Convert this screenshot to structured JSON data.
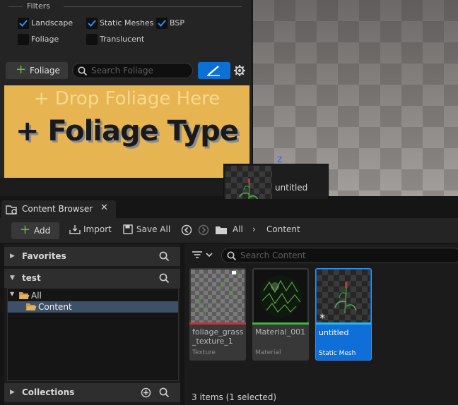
{
  "foliage_panel": {
    "filters_label": "Filters",
    "filters": [
      {
        "label": "Landscape",
        "checked": true
      },
      {
        "label": "Static Meshes",
        "checked": true
      },
      {
        "label": "BSP",
        "checked": true
      },
      {
        "label": "Foliage",
        "checked": false
      },
      {
        "label": "Translucent",
        "checked": false
      }
    ],
    "add_foliage_label": "Foliage",
    "search_placeholder": "Search Foliage",
    "drop_hint": "+ Drop Foliage Here",
    "drop_title": "+ Foliage Type"
  },
  "viewport": {
    "axis_label": "Z"
  },
  "drag_tooltip": {
    "asset_name": "untitled"
  },
  "content_browser": {
    "tab_label": "Content Browser",
    "tab_close": "✕",
    "toolbar": {
      "add_label": "Add",
      "import_label": "Import",
      "save_all_label": "Save All",
      "path": [
        "All",
        "Content"
      ]
    },
    "sources": {
      "favorites_label": "Favorites",
      "project_label": "test",
      "tree": [
        {
          "label": "All",
          "selected": false
        },
        {
          "label": "Content",
          "selected": true
        }
      ],
      "collections_label": "Collections"
    },
    "asset_search_placeholder": "Search Content",
    "assets": [
      {
        "name": "foliage_grass_texture_1",
        "type": "Texture",
        "strip_color": "#c0353b",
        "selected": false
      },
      {
        "name": "Material_001",
        "type": "Material",
        "strip_color": "#40b540",
        "selected": false
      },
      {
        "name": "untitled",
        "type": "Static Mesh",
        "strip_color": "#28b8e8",
        "selected": true
      }
    ],
    "status": "3 items (1 selected)"
  },
  "colors": {
    "accent_blue": "#0f6ed8",
    "add_green": "#5fbf3f",
    "drop_zone": "#e6b551"
  }
}
